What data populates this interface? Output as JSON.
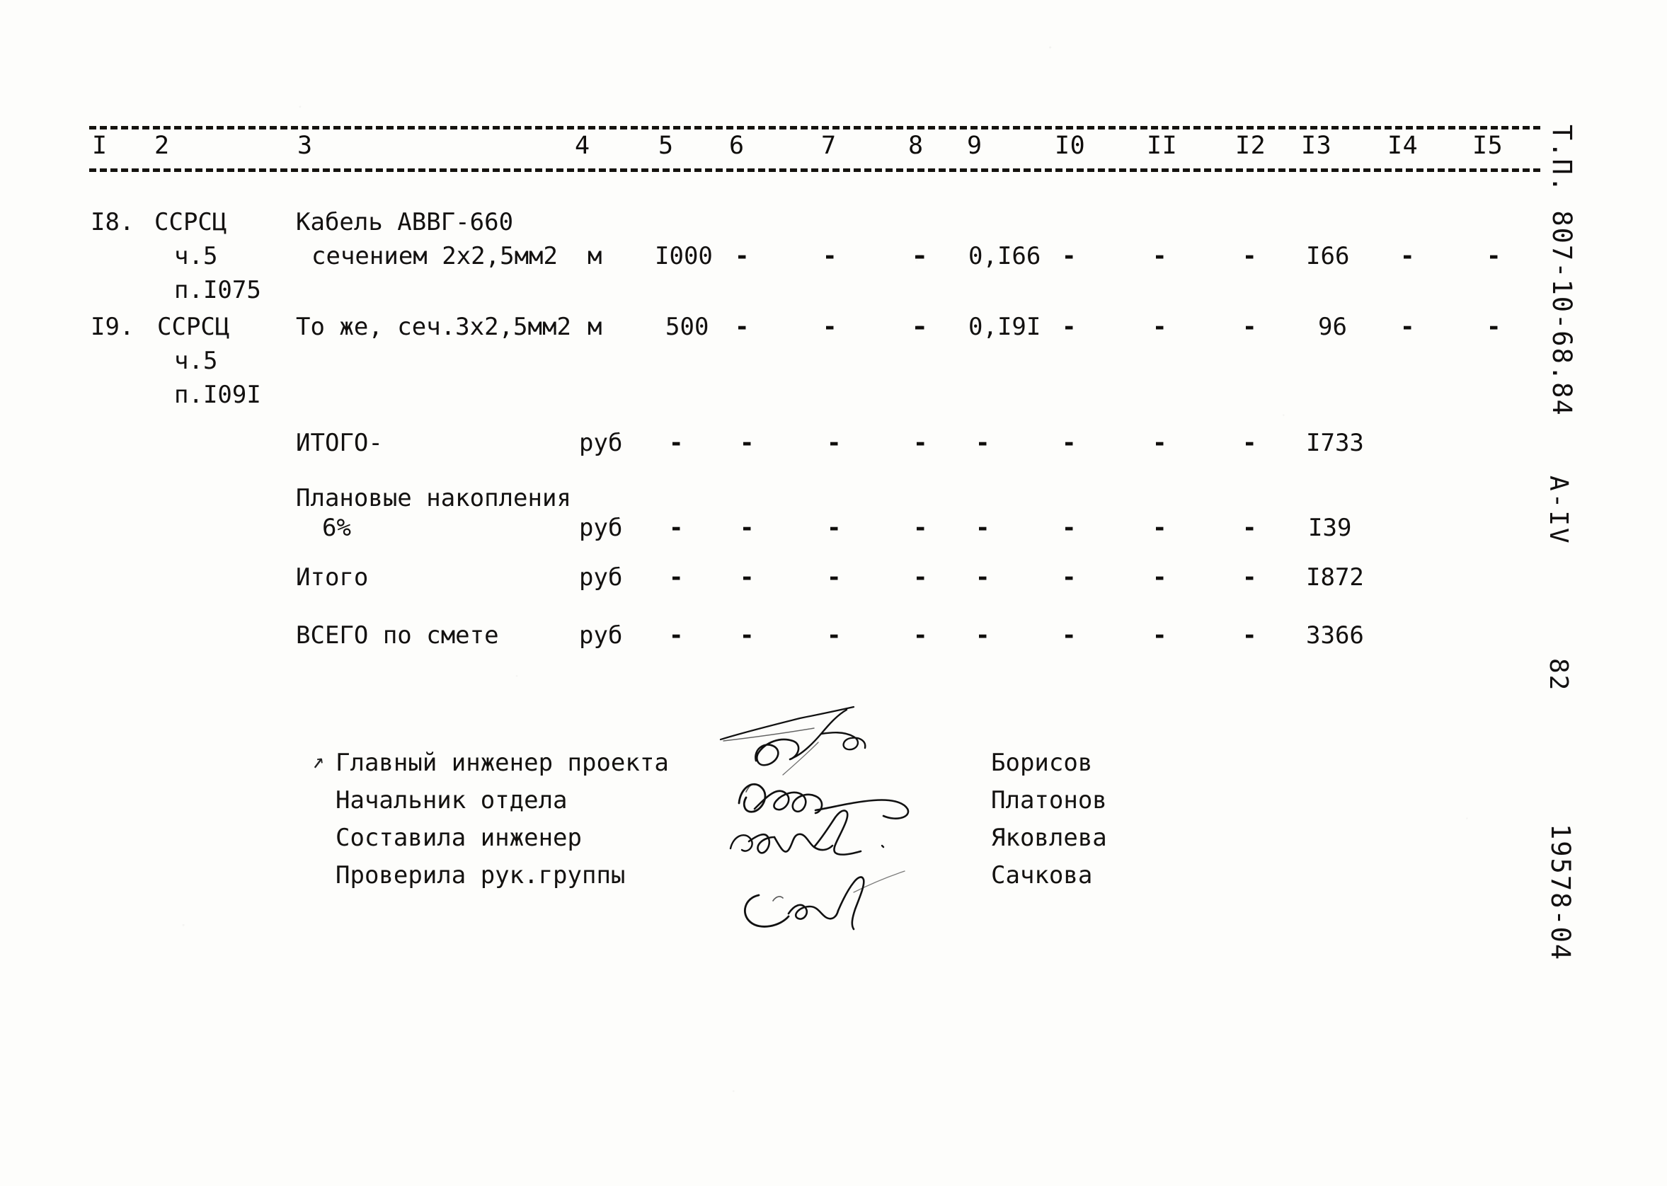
{
  "document": {
    "type": "construction-estimate-scan",
    "language": "ru"
  },
  "table": {
    "column_headers": [
      "I",
      "2",
      "3",
      "4",
      "5",
      "6",
      "7",
      "8",
      "9",
      "I0",
      "II",
      "I2",
      "I3",
      "I4",
      "I5"
    ],
    "rows": [
      {
        "no": "I8.",
        "code_line1": "ССРСЦ",
        "code_line2": "ч.5",
        "code_line3": "п.I075",
        "name_line1": "Кабель АВВГ-660",
        "name_line2": "сечением 2х2,5мм2",
        "unit": "м",
        "qty": "I000",
        "c6": "-",
        "c7": "-",
        "c8": "-",
        "c9": "-",
        "price": "0,I66",
        "c11": "-",
        "c12": "-",
        "c13": "-",
        "total": "I66",
        "c15": "-",
        "c16": "-"
      },
      {
        "no": "I9.",
        "code_line1": "ССРСЦ",
        "code_line2": "ч.5",
        "code_line3": "п.I09I",
        "name_line1": "То же, сеч.3х2,5мм2",
        "name_line2": "",
        "unit": "м",
        "qty": "500",
        "c6": "-",
        "c7": "-",
        "c8": "-",
        "c9": "-",
        "price": "0,I9I",
        "c11": "-",
        "c12": "-",
        "c13": "-",
        "total": "96",
        "c15": "-",
        "c16": "-"
      }
    ],
    "summary_rows": [
      {
        "label_line1": "ИТОГО-",
        "label_line2": "",
        "unit": "руб",
        "dashes": [
          "-",
          "-",
          "-",
          "-",
          "-",
          "-",
          "-",
          "-"
        ],
        "total": "I733"
      },
      {
        "label_line1": "Плановые накопления",
        "label_line2": "6%",
        "unit": "руб",
        "dashes": [
          "-",
          "-",
          "-",
          "-",
          "-",
          "-",
          "-",
          "-"
        ],
        "total": "I39"
      },
      {
        "label_line1": "Итого",
        "label_line2": "",
        "unit": "руб",
        "dashes": [
          "-",
          "-",
          "-",
          "-",
          "-",
          "-",
          "-",
          "-"
        ],
        "total": "I872"
      },
      {
        "label_line1": "ВСЕГО по смете",
        "label_line2": "",
        "unit": "руб",
        "dashes": [
          "-",
          "-",
          "-",
          "-",
          "-",
          "-",
          "-",
          "-"
        ],
        "total": "3366"
      }
    ]
  },
  "signatures": {
    "entries": [
      {
        "role": "Главный инженер проекта",
        "name": "Борисов"
      },
      {
        "role": "Начальник отдела",
        "name": "Платонов"
      },
      {
        "role": "Составила инженер",
        "name": "Яковлева"
      },
      {
        "role": "Проверила рук.группы",
        "name": "Сачкова"
      }
    ],
    "arrow_mark": "↗"
  },
  "margin_notes": {
    "project_code": "Т.П. 807-10-68.84",
    "section": "А-IV",
    "page_number": "82",
    "archive_code": "19578-04"
  },
  "colors": {
    "ink": "#131110",
    "paper": "#fdfdfb"
  }
}
